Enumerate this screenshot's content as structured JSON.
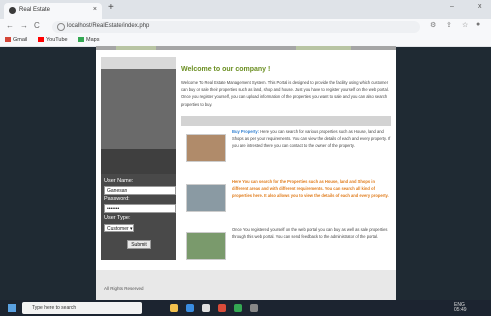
{
  "browser": {
    "tab_title": "Real Estate",
    "tab_close": "×",
    "new_tab": "+",
    "url": "localhost/RealEstate/index.php",
    "back": "←",
    "forward": "→",
    "reload": "C",
    "win_minimize": "–",
    "win_close": "x",
    "bookmarks": [
      {
        "label": "Gmail",
        "color": "#d44638"
      },
      {
        "label": "YouTube",
        "color": "#ff0000"
      },
      {
        "label": "Maps",
        "color": "#34a853"
      }
    ]
  },
  "page": {
    "heading": "Welcome to our company !",
    "intro": "Welcome To Real Estate Management System. This Portal is designed to provide the facility using which customer can buy or sale their properties such as land, shop and house. Just you have to register yourself on the web portal. Once you register yourself, you can upload information of the properties you want to sale and you can also search properties to buy.",
    "items": [
      {
        "lead": "Buy Property:",
        "text": " Here you can search for various properties such as House, land and Shops as per your requirements. You can view the details of each and every property. If you are intrested there you can contact to the owner of the property.",
        "style": "lead"
      },
      {
        "lead": "Here You can search for the Properties such as House, land and Shops in different areas and with different requirements. You can search all kind of properties here. It also allows you to view the details of each and every property.",
        "text": "",
        "style": "orange"
      },
      {
        "lead": "",
        "text": "Once You registered yourself on the web portal you can buy as well as sale properties through this web portal. You can send feedback to the administrator of the portal.",
        "style": "plain"
      }
    ],
    "footer": "All Rights Reserved"
  },
  "login": {
    "username_label": "User Name:",
    "username_value": "Ganesan",
    "password_label": "Password:",
    "password_value": "•••••••",
    "usertype_label": "User Type:",
    "usertype_value": "Customer ▾",
    "submit_label": "Submit"
  },
  "taskbar": {
    "search_placeholder": "Type here to search",
    "lang": "ENG",
    "time": "05:49"
  }
}
